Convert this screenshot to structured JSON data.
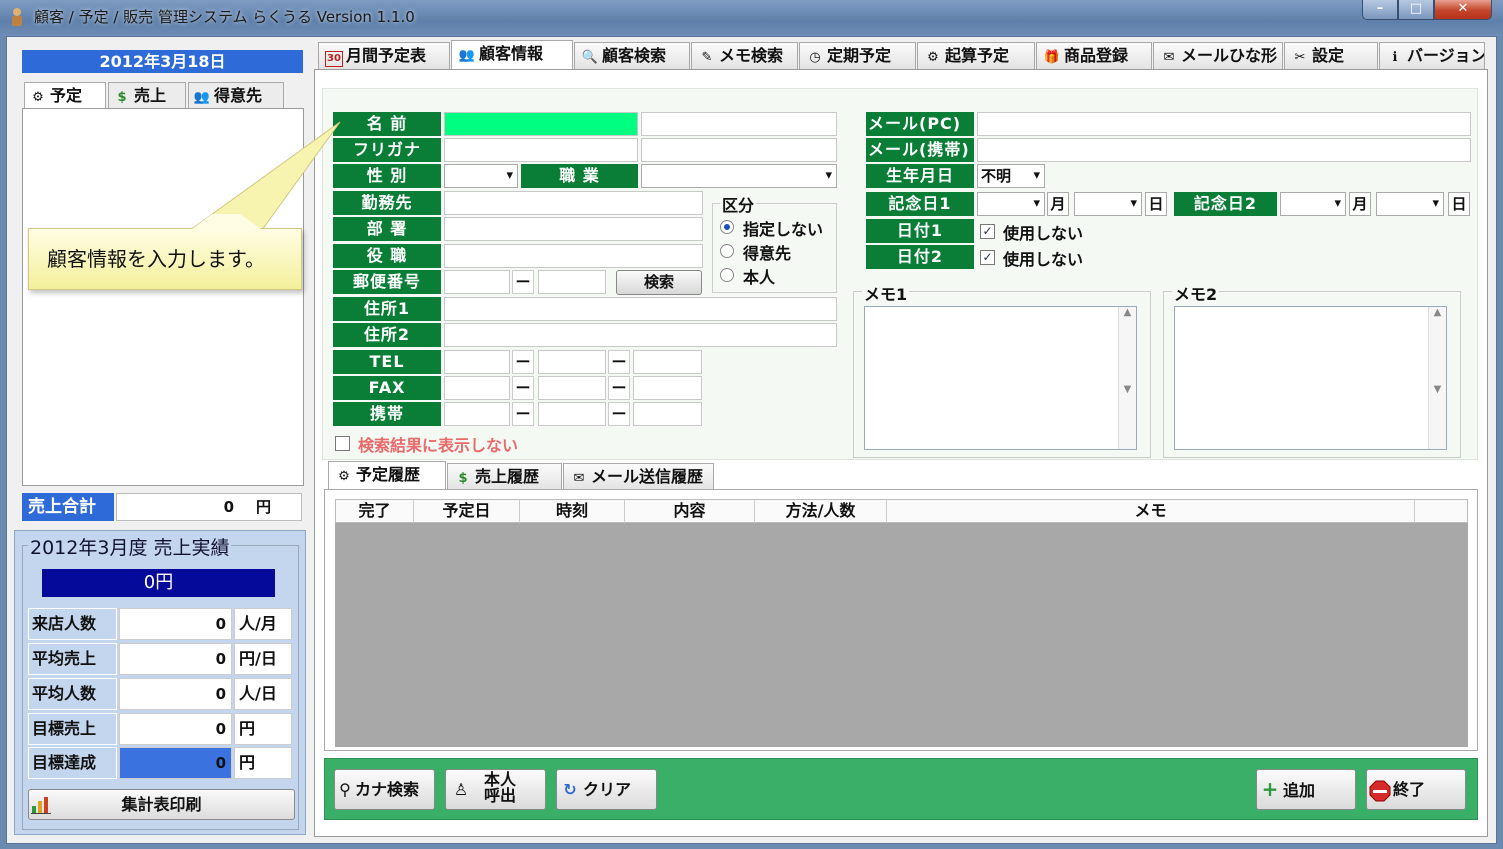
{
  "window": {
    "title": "顧客 / 予定 / 販売 管理システム らくうる  Version 1.1.0",
    "controls": {
      "minimize": "–",
      "maximize": "□",
      "close": "✕"
    }
  },
  "left": {
    "date": "2012年3月18日",
    "tabs": [
      {
        "label": "予定",
        "icon": "⚙"
      },
      {
        "label": "売上",
        "icon": "$"
      },
      {
        "label": "得意先",
        "icon": "👥"
      }
    ],
    "sales_total": {
      "label": "売上合計",
      "value": "0",
      "unit": "円"
    },
    "monthly": {
      "title": "2012年3月度  売上実績",
      "total": "0円",
      "rows": [
        {
          "label": "来店人数",
          "value": "0",
          "unit": "人/月"
        },
        {
          "label": "平均売上",
          "value": "0",
          "unit": "円/日"
        },
        {
          "label": "平均人数",
          "value": "0",
          "unit": "人/日"
        },
        {
          "label": "目標売上",
          "value": "0",
          "unit": "円"
        },
        {
          "label": "目標達成",
          "value": "0",
          "unit": "円"
        }
      ],
      "print_button": "集計表印刷"
    }
  },
  "top_tabs": [
    {
      "label": "月間予定表",
      "icon": "30"
    },
    {
      "label": "顧客情報",
      "icon": "👥"
    },
    {
      "label": "顧客検索",
      "icon": "🔍"
    },
    {
      "label": "メモ検索",
      "icon": "✎"
    },
    {
      "label": "定期予定",
      "icon": "◷"
    },
    {
      "label": "起算予定",
      "icon": "⚙"
    },
    {
      "label": "商品登録",
      "icon": "🎁"
    },
    {
      "label": "メールひな形",
      "icon": "✉"
    },
    {
      "label": "設定",
      "icon": "✂"
    },
    {
      "label": "バージョン",
      "icon": "ℹ"
    }
  ],
  "form": {
    "labels": {
      "name": "名 前",
      "furigana": "フリガナ",
      "gender": "性 別",
      "occupation": "職 業",
      "workplace": "勤務先",
      "department": "部 署",
      "position": "役 職",
      "postal": "郵便番号",
      "address1": "住所1",
      "address2": "住所2",
      "tel": "TEL",
      "fax": "FAX",
      "mobile": "携帯"
    },
    "dash": "ー",
    "search_button": "検索",
    "kubun": {
      "title": "区分",
      "options": [
        "指定しない",
        "得意先",
        "本人"
      ],
      "selected": 0
    },
    "hide_in_search": "検索結果に表示しない",
    "right_labels": {
      "email_pc": "メール(PC)",
      "email_mobile": "メール(携帯)",
      "birthday": "生年月日",
      "anniv1": "記念日1",
      "anniv2": "記念日2",
      "date1": "日付1",
      "date2": "日付2"
    },
    "birthday_value": "不明",
    "month_unit": "月",
    "day_unit": "日",
    "unused_label": "使用しない",
    "memo1": "メモ1",
    "memo2": "メモ2"
  },
  "history_tabs": [
    {
      "label": "予定履歴",
      "icon": "⚙"
    },
    {
      "label": "売上履歴",
      "icon": "$"
    },
    {
      "label": "メール送信履歴",
      "icon": "✉"
    }
  ],
  "grid_columns": [
    "完了",
    "予定日",
    "時刻",
    "内容",
    "方法/人数",
    "メモ"
  ],
  "actions": {
    "kana_search": "カナ検索",
    "self_call_line1": "本人",
    "self_call_line2": "呼出",
    "clear": "クリア",
    "add": "追加",
    "exit": "終了"
  },
  "callout": "顧客情報を入力します。"
}
